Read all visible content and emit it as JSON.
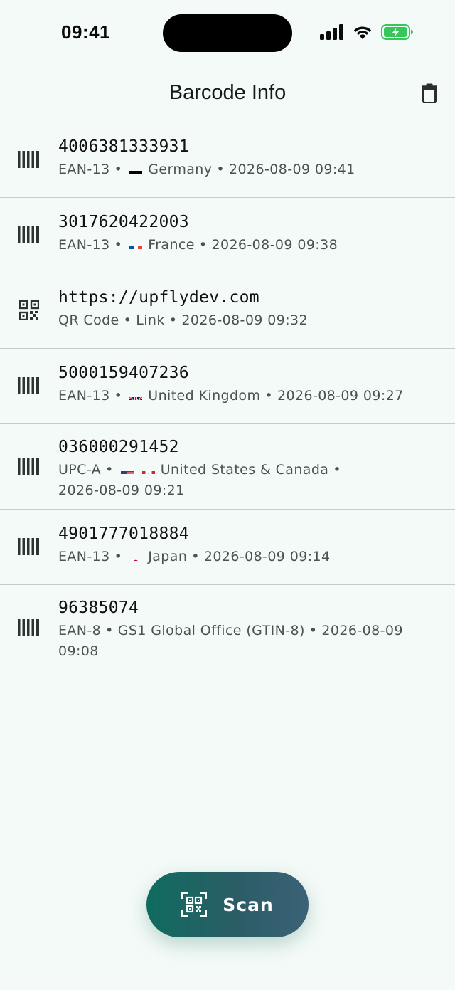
{
  "status_bar": {
    "time": "09:41"
  },
  "header": {
    "title": "Barcode Info",
    "delete_icon": "trash-icon"
  },
  "history": [
    {
      "icon": "barcode-icon",
      "value": "4006381333931",
      "format": "EAN-13",
      "flags": [
        "de"
      ],
      "origin": "Germany",
      "timestamp": "2026-08-09 09:41"
    },
    {
      "icon": "barcode-icon",
      "value": "3017620422003",
      "format": "EAN-13",
      "flags": [
        "fr"
      ],
      "origin": "France",
      "timestamp": "2026-08-09 09:38"
    },
    {
      "icon": "qr-code-icon",
      "value": "https://upflydev.com",
      "format": "QR Code",
      "flags": [],
      "origin": "Link",
      "timestamp": "2026-08-09 09:32"
    },
    {
      "icon": "barcode-icon",
      "value": "5000159407236",
      "format": "EAN-13",
      "flags": [
        "gb"
      ],
      "origin": "United Kingdom",
      "timestamp": "2026-08-09 09:27"
    },
    {
      "icon": "barcode-icon",
      "value": "036000291452",
      "format": "UPC-A",
      "flags": [
        "us",
        "ca"
      ],
      "origin": "United States & Canada",
      "timestamp": "2026-08-09 09:21"
    },
    {
      "icon": "barcode-icon",
      "value": "4901777018884",
      "format": "EAN-13",
      "flags": [
        "jp"
      ],
      "origin": "Japan",
      "timestamp": "2026-08-09 09:14"
    },
    {
      "icon": "barcode-icon",
      "value": "96385074",
      "format": "EAN-8",
      "flags": [],
      "origin": "GS1 Global Office (GTIN-8)",
      "timestamp": "2026-08-09 09:08"
    }
  ],
  "separator": "•",
  "scan_button": {
    "label": "Scan",
    "icon": "qr-scan-icon"
  },
  "colors": {
    "background": "#f4faf7",
    "accent_start": "#0f6b5f",
    "accent_end": "#3b6276",
    "battery": "#34c759"
  }
}
